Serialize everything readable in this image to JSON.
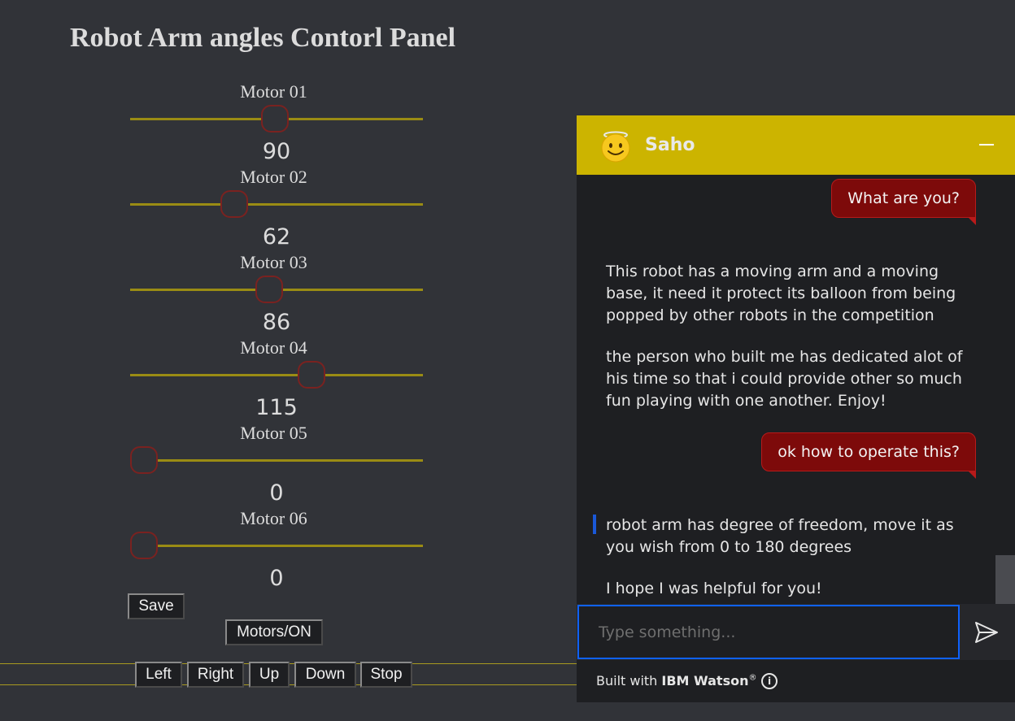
{
  "page": {
    "title": "Robot Arm angles Contorl Panel",
    "accent_color": "#ccb400",
    "track_color": "#9a8c14",
    "thumb_border_color": "#7a2220"
  },
  "motors": [
    {
      "label": "Motor 01",
      "value": "90",
      "min": 0,
      "max": 180
    },
    {
      "label": "Motor 02",
      "value": "62",
      "min": 0,
      "max": 180
    },
    {
      "label": "Motor 03",
      "value": "86",
      "min": 0,
      "max": 180
    },
    {
      "label": "Motor 04",
      "value": "115",
      "min": 0,
      "max": 180
    },
    {
      "label": "Motor 05",
      "value": "0",
      "min": 0,
      "max": 180
    },
    {
      "label": "Motor 06",
      "value": "0",
      "min": 0,
      "max": 180
    }
  ],
  "buttons": {
    "save": "Save",
    "motors_on": "Motors/ON",
    "left": "Left",
    "right": "Right",
    "up": "Up",
    "down": "Down",
    "stop": "Stop"
  },
  "chat": {
    "bot_name": "Saho",
    "avatar_icon": "smiling-face-with-halo-icon",
    "header_color": "#ccb400",
    "messages": [
      {
        "from": "user",
        "text": "What are you?"
      },
      {
        "from": "bot",
        "text": "This robot has a moving arm and a moving base, it need it protect its balloon from being popped by other robots in the competition"
      },
      {
        "from": "bot",
        "text": "the person who built me has dedicated alot of his time so that i could provide other so much fun playing with one another. Enjoy!"
      },
      {
        "from": "user",
        "text": "ok how to operate this?"
      },
      {
        "from": "bot",
        "text": "robot arm has degree of freedom, move it as you wish from 0 to 180 degrees"
      },
      {
        "from": "bot",
        "text": "I hope I was helpful for you!"
      }
    ],
    "input_placeholder": "Type something...",
    "help_label": "?",
    "footer_prefix": "Built with ",
    "footer_brand": "IBM Watson",
    "footer_mark": "®",
    "info_label": "i"
  }
}
